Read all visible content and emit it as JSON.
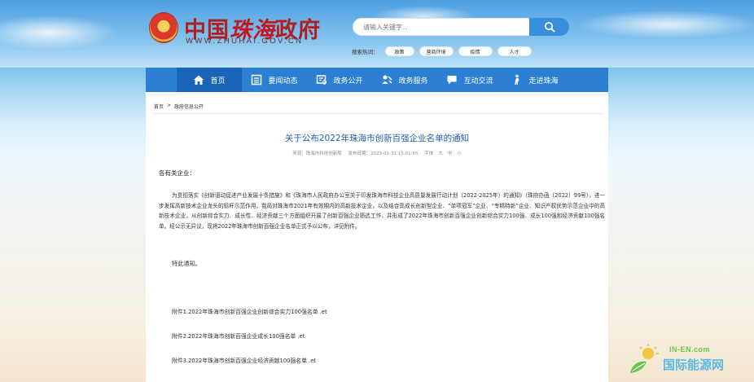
{
  "header": {
    "logo_text_a": "中国",
    "logo_text_b": "珠海",
    "logo_text_c": "政府",
    "logo_url": "WWW.ZHUHAI.GOV.CN",
    "search_placeholder": "请输入关键字...",
    "hot_label": "搜索热词：",
    "hot_tags": [
      "政策",
      "营商环境",
      "疫情",
      "人才"
    ]
  },
  "nav": {
    "items": [
      {
        "label": "首页",
        "icon": "home-icon"
      },
      {
        "label": "要闻动态",
        "icon": "news-icon"
      },
      {
        "label": "政务公开",
        "icon": "open-gov-icon"
      },
      {
        "label": "政务服务",
        "icon": "service-icon"
      },
      {
        "label": "互动交流",
        "icon": "chat-icon"
      },
      {
        "label": "走进珠海",
        "icon": "walk-icon"
      }
    ],
    "active_index": 0
  },
  "breadcrumb": {
    "home": "首页",
    "sep": ">",
    "current": "政府信息公开"
  },
  "article": {
    "title": "关于公布2022年珠海市创新百强企业名单的通知",
    "source": "来源：珠海市科技创新局",
    "date": "发布日期：2023-01-31 15:01:55",
    "font_label": "字体",
    "font_sizes": [
      "大",
      "中",
      "小"
    ],
    "salutation": "各有关企业：",
    "body": "为贯彻落实《创新驱动促进产业发展十条措施》和《珠海市人民政府办公室关于印发珠海市科技企业高质量发展行动计划（2022-2025年）的通知》（珠府办函〔2022〕99号），进一步发挥高新技术企业龙头的标杆示范作用，我局对珠海市2021年有效期内的高新技术企业，以及结合高成长创新型企业、“单项冠军”企业、“专精特新”企业、知识产权优势示范企业中的高新技术企业，从创新综合实力、成长性、经济贡献三个方面组织开展了创新百强企业筛选工作，并形成了2022年珠海市创新百强企业创新综合实力100强、成长100强和经济贡献100强名单。经公示无异议，现将2022年珠海市创新百强企业名单正式予以公布，详见附件。",
    "notice": "特此通知。",
    "attachments": [
      "附件1.2022年珠海市创新百强企业创新综合实力100强名单 .et",
      "附件2.2022年珠海市创新百强企业成长100强名单 .et",
      "附件3.2022年珠海市创新百强企业经济贡献100强名单 .et"
    ]
  },
  "watermark": {
    "en": "IN-EN.com",
    "cn": "国际能源网"
  },
  "colors": {
    "nav_bg": "#2c7fd3",
    "nav_active": "#1b65b8",
    "title": "#1d5fae",
    "logo": "#b01e1e",
    "search_btn": "#3a8fdc"
  }
}
